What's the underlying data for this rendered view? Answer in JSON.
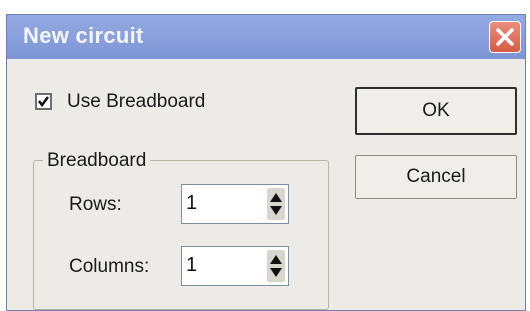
{
  "dialog": {
    "title": "New circuit",
    "use_breadboard": {
      "label": "Use Breadboard",
      "checked": true
    },
    "breadboard_group": {
      "legend": "Breadboard",
      "rows": {
        "label": "Rows:",
        "value": "1"
      },
      "columns": {
        "label": "Columns:",
        "value": "1"
      }
    },
    "buttons": {
      "ok": "OK",
      "cancel": "Cancel"
    }
  },
  "icons": {
    "close": "close-icon",
    "check": "check-icon",
    "spin": "up-down-arrows-icon"
  },
  "colors": {
    "titlebar": "#8aa1dd",
    "title_text": "#f4f6ff",
    "close_button": "#d65c45",
    "dialog_background": "#ecebe6"
  }
}
